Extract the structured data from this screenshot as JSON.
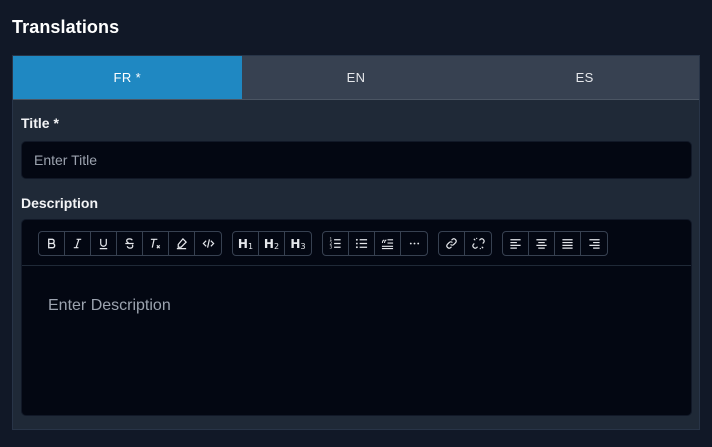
{
  "section": {
    "title": "Translations"
  },
  "tabs": [
    {
      "label": "FR *",
      "active": true
    },
    {
      "label": "EN",
      "active": false
    },
    {
      "label": "ES",
      "active": false
    }
  ],
  "form": {
    "title_label": "Title",
    "title_required": "*",
    "title_placeholder": "Enter Title",
    "description_label": "Description",
    "description_placeholder": "Enter Description"
  },
  "toolbar": {
    "groups": [
      [
        "bold-icon",
        "italic-icon",
        "underline-icon",
        "strikethrough-icon",
        "clear-format-icon",
        "highlight-icon",
        "code-icon"
      ],
      [
        "heading-1-icon",
        "heading-2-icon",
        "heading-3-icon"
      ],
      [
        "ordered-list-icon",
        "bullet-list-icon",
        "blockquote-icon",
        "more-icon"
      ],
      [
        "link-icon",
        "unlink-icon"
      ],
      [
        "align-left-icon",
        "align-center-icon",
        "align-justify-icon",
        "align-right-icon"
      ]
    ],
    "headings": {
      "h1": "H",
      "h1_sub": "1",
      "h2": "H",
      "h2_sub": "2",
      "h3": "H",
      "h3_sub": "3"
    }
  },
  "colors": {
    "accent": "#1f88c2",
    "background": "#111827",
    "panel": "#1f2937",
    "input": "#030712"
  }
}
